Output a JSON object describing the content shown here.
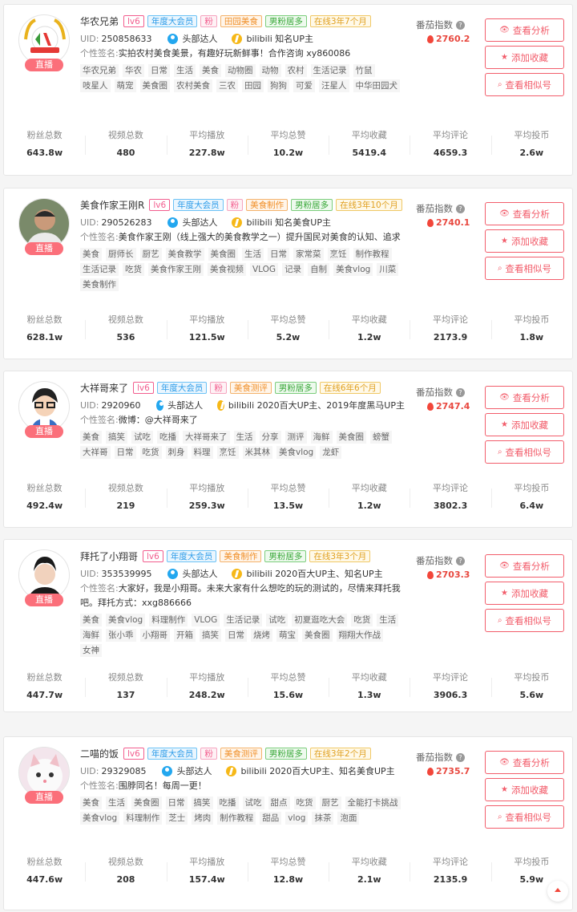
{
  "accent_color": "#f25d6b",
  "labels": {
    "uid": "UID:",
    "signature_prefix": "个性签名:",
    "score_label": "番茄指数",
    "buttons": [
      "查看分析",
      "添加收藏",
      "查看相似号"
    ],
    "button_icons": [
      "eye-icon",
      "star-icon",
      "search-icon"
    ],
    "stats": [
      "粉丝总数",
      "视频总数",
      "平均播放",
      "平均总赞",
      "平均收藏",
      "平均评论",
      "平均投币"
    ],
    "live": "直播",
    "level_tag": "头部达人"
  },
  "cards": [
    {
      "name": "华农兄弟",
      "badges": [
        "lv6",
        "年度大会员",
        "粉",
        "田园美食",
        "男粉居多",
        "在线3年7个月"
      ],
      "uid": "250858633",
      "cert": "bilibili 知名UP主",
      "signature": "实拍农村美食美景，有趣好玩新鲜事！合作咨询 xy860086",
      "tags": [
        "华农兄弟",
        "华农",
        "日常",
        "生活",
        "美食",
        "动物圈",
        "动物",
        "农村",
        "生活记录",
        "竹鼠",
        "吱星人",
        "萌宠",
        "美食圈",
        "农村美食",
        "三农",
        "田园",
        "狗狗",
        "可爱",
        "汪星人",
        "中华田园犬"
      ],
      "score": "2760.2",
      "stats": [
        "643.8w",
        "480",
        "227.8w",
        "10.2w",
        "5419.4",
        "4659.3",
        "2.6w"
      ]
    },
    {
      "name": "美食作家王刚R",
      "badges": [
        "lv6",
        "年度大会员",
        "粉",
        "美食制作",
        "男粉居多",
        "在线3年10个月"
      ],
      "uid": "290526283",
      "cert": "bilibili 知名美食UP主",
      "signature": "美食作家王刚（线上强大的美食教学之一）提升国民对美食的认知、追求",
      "tags": [
        "美食",
        "厨师长",
        "厨艺",
        "美食教学",
        "美食圈",
        "生活",
        "日常",
        "家常菜",
        "烹饪",
        "制作教程",
        "生活记录",
        "吃货",
        "美食作家王刚",
        "美食视频",
        "VLOG",
        "记录",
        "自制",
        "美食vlog",
        "川菜",
        "美食制作"
      ],
      "score": "2740.1",
      "stats": [
        "628.1w",
        "536",
        "121.5w",
        "5.2w",
        "1.2w",
        "2173.9",
        "1.8w"
      ]
    },
    {
      "name": "大祥哥来了",
      "badges": [
        "lv6",
        "年度大会员",
        "粉",
        "美食测评",
        "男粉居多",
        "在线6年6个月"
      ],
      "uid": "2920960",
      "cert": "bilibili 2020百大UP主、2019年度黑马UP主",
      "signature": "微博：@大祥哥来了",
      "tags": [
        "美食",
        "搞笑",
        "试吃",
        "吃播",
        "大祥哥来了",
        "生活",
        "分享",
        "测评",
        "海鲜",
        "美食圈",
        "螃蟹",
        "大祥哥",
        "日常",
        "吃货",
        "刺身",
        "料理",
        "烹饪",
        "米其林",
        "美食vlog",
        "龙虾"
      ],
      "score": "2747.4",
      "stats": [
        "492.4w",
        "219",
        "259.3w",
        "13.5w",
        "1.2w",
        "3802.3",
        "6.4w"
      ]
    },
    {
      "name": "拜托了小翔哥",
      "badges": [
        "lv6",
        "年度大会员",
        "美食制作",
        "男粉居多",
        "在线3年3个月"
      ],
      "uid": "353539995",
      "cert": "bilibili 2020百大UP主、知名UP主",
      "signature": "大家好，我是小翔哥。未来大家有什么想吃的玩的测试的，尽情来拜托我吧。拜托方式：xxg886666",
      "tags": [
        "美食",
        "美食vlog",
        "料理制作",
        "VLOG",
        "生活记录",
        "试吃",
        "初夏逛吃大会",
        "吃货",
        "生活",
        "海鲜",
        "张小乖",
        "小翔哥",
        "开箱",
        "搞笑",
        "日常",
        "烧烤",
        "萌宝",
        "美食圈",
        "翔翔大作战",
        "女神"
      ],
      "score": "2703.3",
      "stats": [
        "447.7w",
        "137",
        "248.2w",
        "15.6w",
        "1.3w",
        "3906.3",
        "5.6w"
      ]
    },
    {
      "name": "二喵的饭",
      "badges": [
        "lv6",
        "年度大会员",
        "粉",
        "美食测评",
        "男粉居多",
        "在线3年2个月"
      ],
      "uid": "29329085",
      "cert": "bilibili 2020百大UP主、知名美食UP主",
      "signature": "围脖同名！每周一更！",
      "tags": [
        "美食",
        "生活",
        "美食圈",
        "日常",
        "搞笑",
        "吃播",
        "试吃",
        "甜点",
        "吃货",
        "厨艺",
        "全能打卡挑战",
        "美食vlog",
        "料理制作",
        "芝士",
        "烤肉",
        "制作教程",
        "甜品",
        "vlog",
        "抹茶",
        "泡面"
      ],
      "score": "2735.7",
      "stats": [
        "447.6w",
        "208",
        "157.4w",
        "12.8w",
        "2.1w",
        "2135.9",
        "5.9w"
      ]
    }
  ]
}
